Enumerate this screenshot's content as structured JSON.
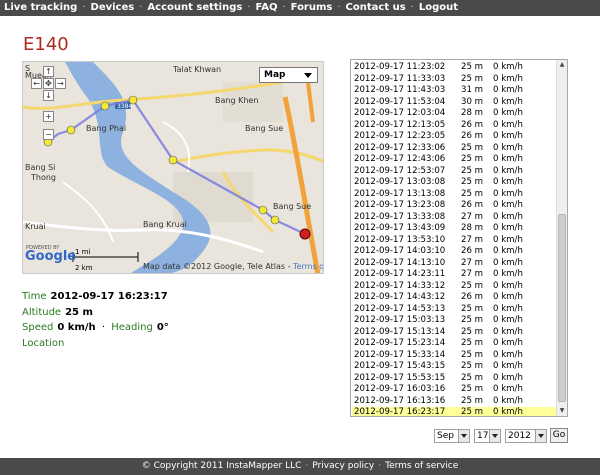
{
  "nav": {
    "items": [
      {
        "label": "Live tracking"
      },
      {
        "label": "Devices"
      },
      {
        "label": "Account settings"
      },
      {
        "label": "FAQ"
      },
      {
        "label": "Forums"
      },
      {
        "label": "Contact us"
      },
      {
        "label": "Logout"
      }
    ],
    "separator": "·"
  },
  "page": {
    "title": "E140"
  },
  "map": {
    "type_control": "Map",
    "labels": {
      "talat_khwan": "Talat Khwan",
      "bang_khen": "Bang Khen",
      "bang_phai": "Bang Phai",
      "bang_sue_top": "Bang Sue",
      "bang_sue_bottom": "Bang Sue",
      "bang_si": "Bang Si",
      "thong": "Thong",
      "kruai": "Kruai",
      "bang_kruai": "Bang Kruai",
      "route_sign": "3384",
      "muean": "Muean",
      "s_top": "S"
    },
    "scale": {
      "mi": "1 mi",
      "km": "2 km"
    },
    "attribution": "Map data ©2012 Google, Tele Atlas -",
    "terms_link": "Terms of Use",
    "logo": "Google",
    "powered_by": "POWERED BY",
    "colors": {
      "track": "#7a7ae0",
      "point": "#f2e83a",
      "endpoint": "#d02020",
      "river": "#7aa5d6"
    }
  },
  "info": {
    "time_label": "Time",
    "time_value": "2012-09-17 16:23:17",
    "altitude_label": "Altitude",
    "altitude_value": "25 m",
    "speed_label": "Speed",
    "speed_value": "0 km/h",
    "heading_label": "Heading",
    "heading_value": "0°",
    "location_label": "Location"
  },
  "log": {
    "rows": [
      {
        "time": "2012-09-17 11:23:02",
        "alt": "25 m",
        "speed": "0 km/h"
      },
      {
        "time": "2012-09-17 11:33:03",
        "alt": "25 m",
        "speed": "0 km/h"
      },
      {
        "time": "2012-09-17 11:43:03",
        "alt": "31 m",
        "speed": "0 km/h"
      },
      {
        "time": "2012-09-17 11:53:04",
        "alt": "30 m",
        "speed": "0 km/h"
      },
      {
        "time": "2012-09-17 12:03:04",
        "alt": "28 m",
        "speed": "0 km/h"
      },
      {
        "time": "2012-09-17 12:13:05",
        "alt": "26 m",
        "speed": "0 km/h"
      },
      {
        "time": "2012-09-17 12:23:05",
        "alt": "26 m",
        "speed": "0 km/h"
      },
      {
        "time": "2012-09-17 12:33:06",
        "alt": "25 m",
        "speed": "0 km/h"
      },
      {
        "time": "2012-09-17 12:43:06",
        "alt": "25 m",
        "speed": "0 km/h"
      },
      {
        "time": "2012-09-17 12:53:07",
        "alt": "25 m",
        "speed": "0 km/h"
      },
      {
        "time": "2012-09-17 13:03:08",
        "alt": "25 m",
        "speed": "0 km/h"
      },
      {
        "time": "2012-09-17 13:13:08",
        "alt": "25 m",
        "speed": "0 km/h"
      },
      {
        "time": "2012-09-17 13:23:08",
        "alt": "26 m",
        "speed": "0 km/h"
      },
      {
        "time": "2012-09-17 13:33:08",
        "alt": "27 m",
        "speed": "0 km/h"
      },
      {
        "time": "2012-09-17 13:43:09",
        "alt": "28 m",
        "speed": "0 km/h"
      },
      {
        "time": "2012-09-17 13:53:10",
        "alt": "27 m",
        "speed": "0 km/h"
      },
      {
        "time": "2012-09-17 14:03:10",
        "alt": "26 m",
        "speed": "0 km/h"
      },
      {
        "time": "2012-09-17 14:13:10",
        "alt": "27 m",
        "speed": "0 km/h"
      },
      {
        "time": "2012-09-17 14:23:11",
        "alt": "27 m",
        "speed": "0 km/h"
      },
      {
        "time": "2012-09-17 14:33:12",
        "alt": "25 m",
        "speed": "0 km/h"
      },
      {
        "time": "2012-09-17 14:43:12",
        "alt": "26 m",
        "speed": "0 km/h"
      },
      {
        "time": "2012-09-17 14:53:13",
        "alt": "25 m",
        "speed": "0 km/h"
      },
      {
        "time": "2012-09-17 15:03:13",
        "alt": "25 m",
        "speed": "0 km/h"
      },
      {
        "time": "2012-09-17 15:13:14",
        "alt": "25 m",
        "speed": "0 km/h"
      },
      {
        "time": "2012-09-17 15:23:14",
        "alt": "25 m",
        "speed": "0 km/h"
      },
      {
        "time": "2012-09-17 15:33:14",
        "alt": "25 m",
        "speed": "0 km/h"
      },
      {
        "time": "2012-09-17 15:43:15",
        "alt": "25 m",
        "speed": "0 km/h"
      },
      {
        "time": "2012-09-17 15:53:15",
        "alt": "25 m",
        "speed": "0 km/h"
      },
      {
        "time": "2012-09-17 16:03:16",
        "alt": "25 m",
        "speed": "0 km/h"
      },
      {
        "time": "2012-09-17 16:13:16",
        "alt": "25 m",
        "speed": "0 km/h"
      },
      {
        "time": "2012-09-17 16:23:17",
        "alt": "25 m",
        "speed": "0 km/h"
      }
    ],
    "selected_index": 30,
    "highlight_color": "#ffff99"
  },
  "date_picker": {
    "month": "Sep",
    "day": "17",
    "year": "2012",
    "go_label": "Go"
  },
  "footer": {
    "copyright": "© Copyright 2011 InstaMapper LLC",
    "privacy": "Privacy policy",
    "terms": "Terms of service",
    "separator": "·"
  }
}
